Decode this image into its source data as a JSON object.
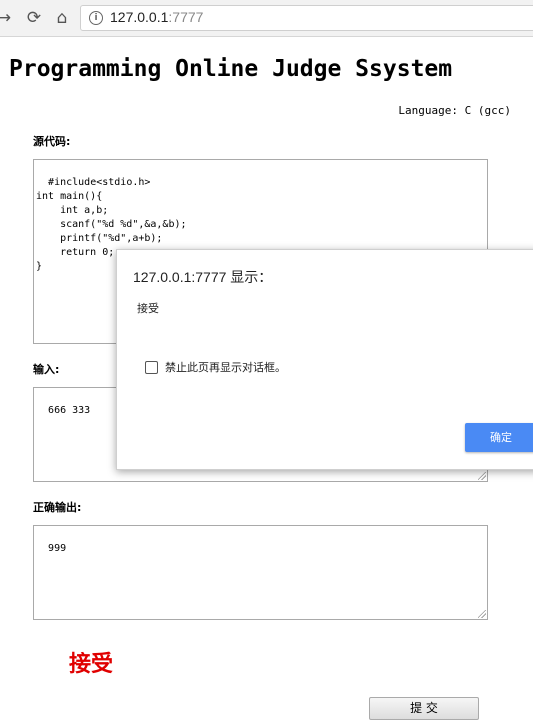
{
  "browser": {
    "url_host": "127.0.0.1",
    "url_port": ":7777",
    "back_icon": "→",
    "reload_icon": "⟳",
    "home_icon": "⌂",
    "info_icon": "i"
  },
  "page": {
    "title": "Programming Online Judge Ssystem",
    "language": "Language: C (gcc)",
    "source_label": "源代码:",
    "source_code": "#include<stdio.h>\nint main(){\n    int a,b;\n    scanf(\"%d %d\",&a,&b);\n    printf(\"%d\",a+b);\n    return 0;\n}",
    "input_label": "输入:",
    "input_value": "666 333",
    "expected_label": "正确输出:",
    "expected_value": "999",
    "result": "接受",
    "submit_label": "提 交",
    "result_color": "#e00000"
  },
  "dialog": {
    "title": "127.0.0.1:7777 显示：",
    "message": "接受",
    "checkbox_label": "禁止此页再显示对话框。",
    "ok_label": "确定",
    "ok_color": "#4a8af4"
  }
}
